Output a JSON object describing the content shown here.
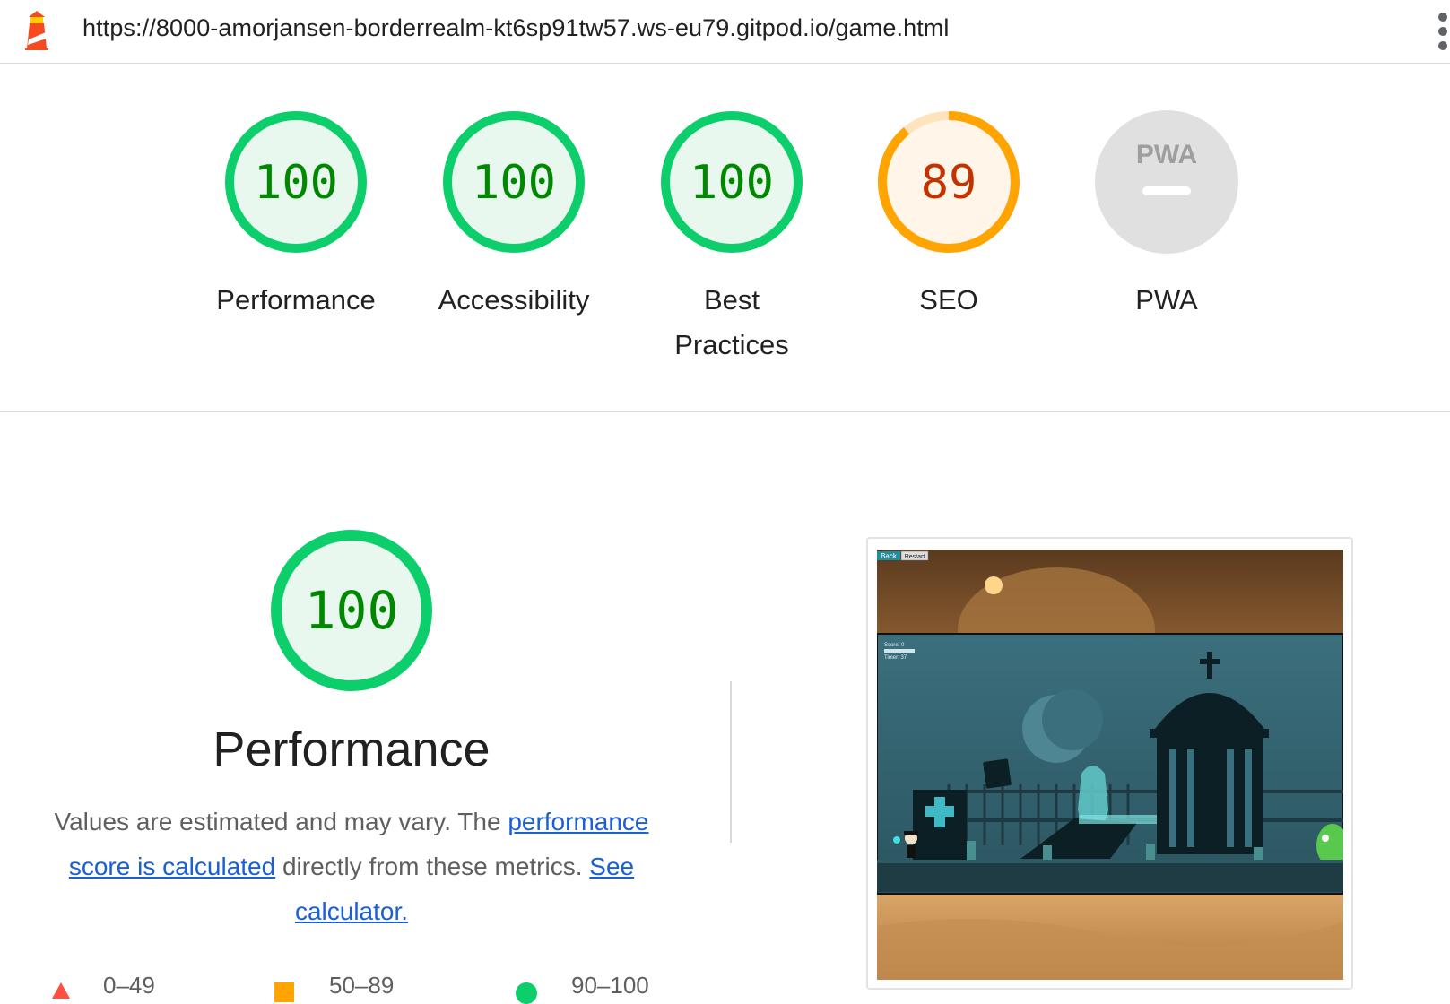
{
  "browser": {
    "url": "https://8000-amorjansen-borderrealm-kt6sp91tw57.ws-eu79.gitpod.io/game.html",
    "logo_icon": "lighthouse-icon",
    "menu_icon": "kebab-menu-icon"
  },
  "gauges": [
    {
      "score": "100",
      "label": "Performance",
      "status": "pass"
    },
    {
      "score": "100",
      "label": "Accessibility",
      "status": "pass"
    },
    {
      "score": "100",
      "label": "Best Practices",
      "status": "pass"
    },
    {
      "score": "89",
      "label": "SEO",
      "status": "average",
      "fraction": 0.89
    },
    {
      "score": "",
      "label": "PWA",
      "badge": "PWA",
      "status": "na"
    }
  ],
  "colors": {
    "pass": "#0cce6b",
    "pass_bg": "#e8f8ee",
    "pass_text": "#008800",
    "average": "#ffa400",
    "average_bg": "#fff5e8",
    "average_text": "#c33300",
    "fail": "#ff4e42",
    "na": "#e0e0e0",
    "link": "#1a5fd6"
  },
  "performance": {
    "score": "100",
    "title": "Performance",
    "desc_part1": "Values are estimated and may vary. The ",
    "link1": "performance score is calculated",
    "desc_part2": " directly from these metrics. ",
    "link2": "See calculator."
  },
  "legend": [
    {
      "range": "0–49",
      "shape": "triangle"
    },
    {
      "range": "50–89",
      "shape": "square"
    },
    {
      "range": "90–100",
      "shape": "circle"
    }
  ],
  "screenshot": {
    "back_label": "Back",
    "restart_label": "Restart",
    "hud_score": "Score: 0",
    "hud_timer": "Timer: 37"
  }
}
